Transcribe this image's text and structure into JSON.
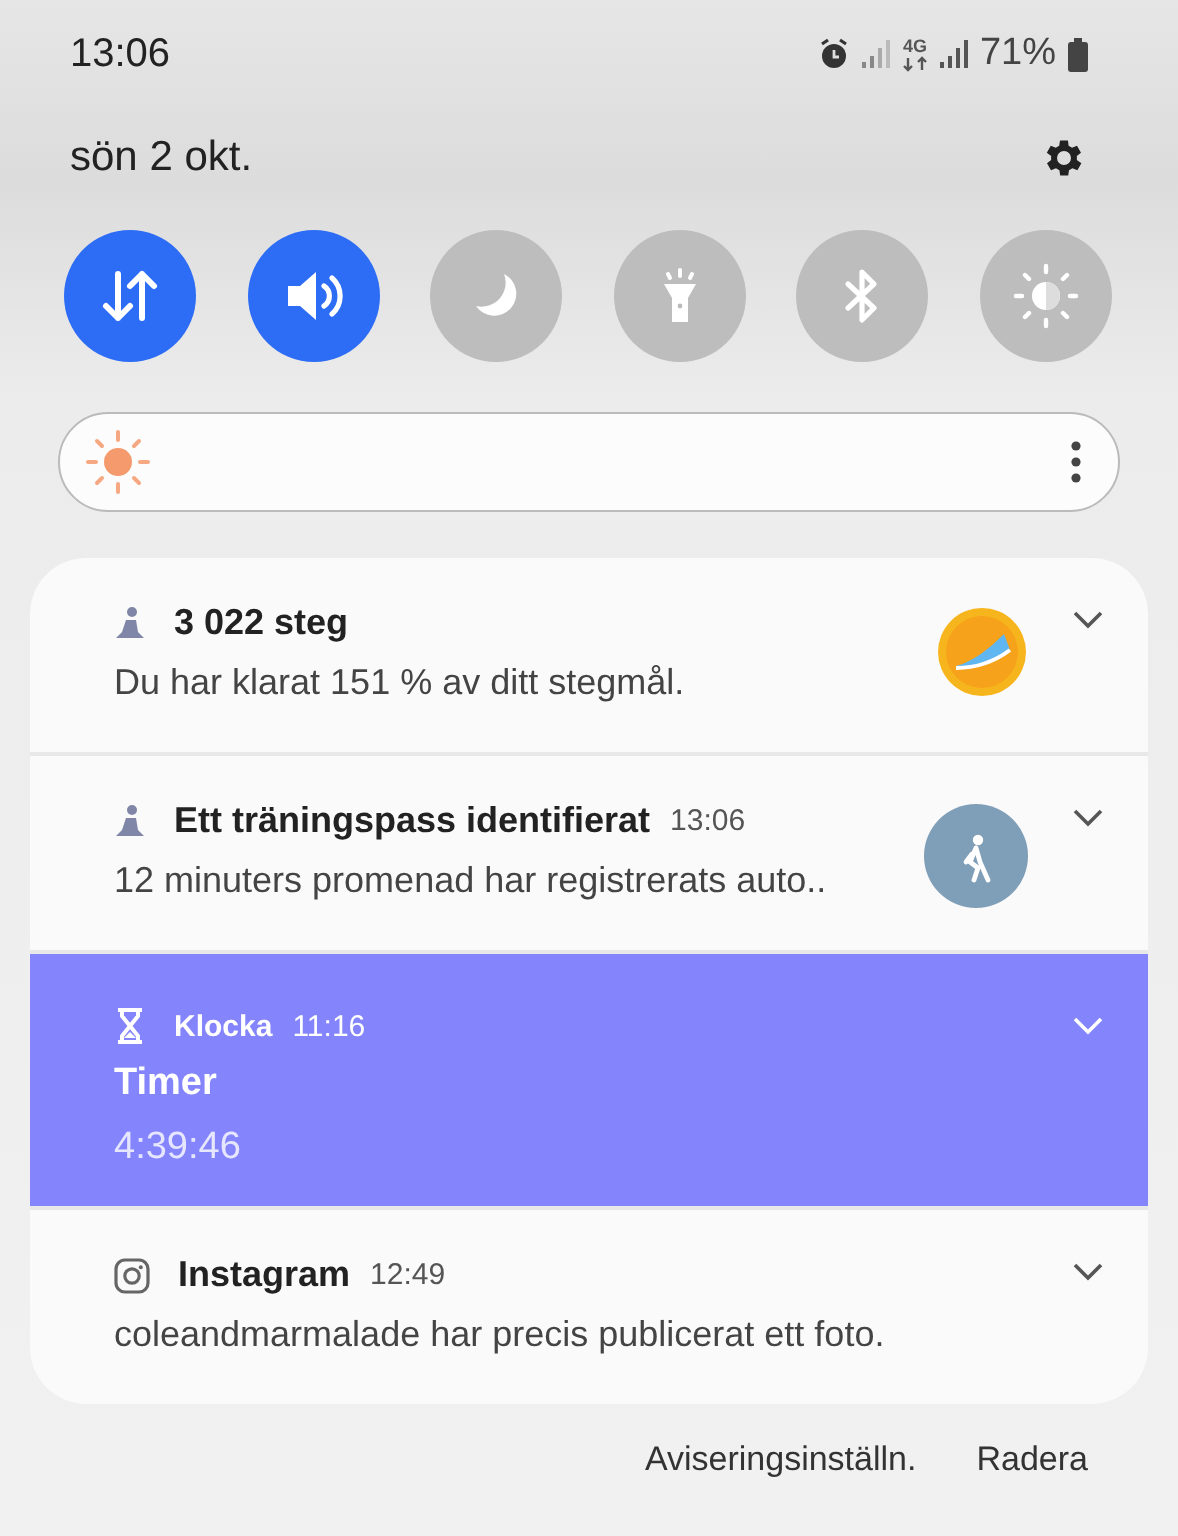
{
  "status_bar": {
    "time": "13:06",
    "network": "4G",
    "battery": "71%"
  },
  "date": "sön 2 okt.",
  "toggles": [
    {
      "kind": "data",
      "on": true
    },
    {
      "kind": "sound",
      "on": true
    },
    {
      "kind": "night",
      "on": false
    },
    {
      "kind": "flashlight",
      "on": false
    },
    {
      "kind": "bluetooth",
      "on": false
    },
    {
      "kind": "eye-comfort",
      "on": false
    }
  ],
  "notifications": [
    {
      "kind": "steps",
      "header": "3 022 steg",
      "text": "Du har klarat 151 % av ditt stegmål.",
      "highlighted": false
    },
    {
      "kind": "workout",
      "header": "Ett träningspass identifierat",
      "time": "13:06",
      "text": "12 minuters promenad har registrerats auto..",
      "highlighted": false
    },
    {
      "kind": "timer",
      "header": "Klocka",
      "time": "11:16",
      "title": "Timer",
      "text": "4:39:46",
      "highlighted": true
    },
    {
      "kind": "photo",
      "header": "Instagram",
      "time": "12:49",
      "text": "coleandmarmalade har precis publicerat ett foto.",
      "highlighted": false
    }
  ],
  "footer_buttons": [
    "Aviseringsinställn.",
    "Radera"
  ]
}
